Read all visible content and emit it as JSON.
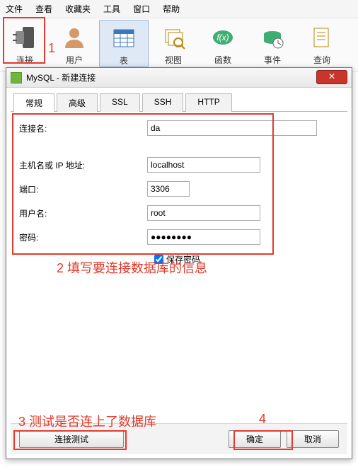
{
  "menu": {
    "file": "文件",
    "view": "查看",
    "fav": "收藏夹",
    "tools": "工具",
    "window": "窗口",
    "help": "帮助"
  },
  "ribbon": {
    "connect": "连接",
    "user": "用户",
    "table": "表",
    "view": "视图",
    "func": "函数",
    "event": "事件",
    "query": "查询"
  },
  "dialog": {
    "title": "MySQL - 新建连接",
    "close_x": "✕",
    "tabs": {
      "general": "常规",
      "advanced": "高级",
      "ssl": "SSL",
      "ssh": "SSH",
      "http": "HTTP"
    },
    "labels": {
      "conn_name": "连接名:",
      "host": "主机名或 IP 地址:",
      "port": "端口:",
      "user": "用户名:",
      "pass": "密码:",
      "save_pass": "保存密码"
    },
    "values": {
      "conn_name": "da",
      "host": "localhost",
      "port": "3306",
      "user": "root",
      "pass": "●●●●●●●●"
    },
    "buttons": {
      "test": "连接测试",
      "ok": "确定",
      "cancel": "取消"
    }
  },
  "annotations": {
    "a1": "1",
    "a2": "2 填写要连接数据库的信息",
    "a3": "3 测试是否连上了数据库",
    "a4": "4"
  }
}
